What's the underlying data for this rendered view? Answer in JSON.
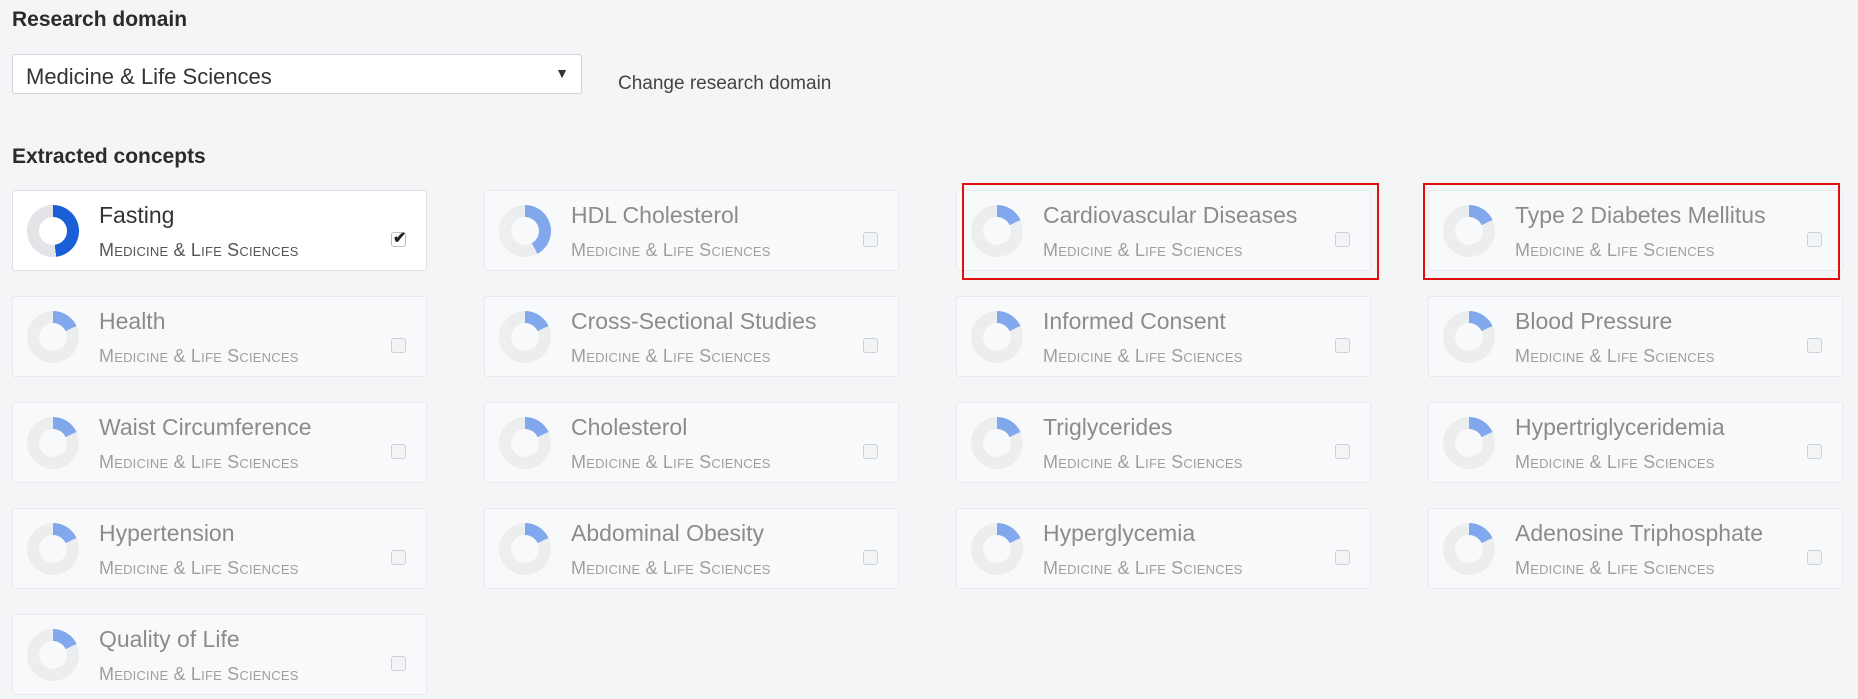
{
  "research_domain": {
    "heading": "Research domain",
    "selected": "Medicine & Life Sciences",
    "caret": "▼",
    "change_link": "Change research domain"
  },
  "concepts": {
    "heading": "Extracted concepts",
    "check_glyph": "✔",
    "items": [
      {
        "title": "Fasting",
        "category": "Medicine & Life Sciences",
        "checked": true,
        "weight": "strong"
      },
      {
        "title": "HDL Cholesterol",
        "category": "Medicine & Life Sciences",
        "checked": false,
        "weight": "mid"
      },
      {
        "title": "Cardiovascular Diseases",
        "category": "Medicine & Life Sciences",
        "checked": false,
        "weight": "low",
        "highlighted": true
      },
      {
        "title": "Type 2 Diabetes Mellitus",
        "category": "Medicine & Life Sciences",
        "checked": false,
        "weight": "low",
        "highlighted": true
      },
      {
        "title": "Health",
        "category": "Medicine & Life Sciences",
        "checked": false,
        "weight": "low"
      },
      {
        "title": "Cross-Sectional Studies",
        "category": "Medicine & Life Sciences",
        "checked": false,
        "weight": "low"
      },
      {
        "title": "Informed Consent",
        "category": "Medicine & Life Sciences",
        "checked": false,
        "weight": "low"
      },
      {
        "title": "Blood Pressure",
        "category": "Medicine & Life Sciences",
        "checked": false,
        "weight": "low"
      },
      {
        "title": "Waist Circumference",
        "category": "Medicine & Life Sciences",
        "checked": false,
        "weight": "low"
      },
      {
        "title": "Cholesterol",
        "category": "Medicine & Life Sciences",
        "checked": false,
        "weight": "low"
      },
      {
        "title": "Triglycerides",
        "category": "Medicine & Life Sciences",
        "checked": false,
        "weight": "low"
      },
      {
        "title": "Hypertriglyceridemia",
        "category": "Medicine & Life Sciences",
        "checked": false,
        "weight": "low"
      },
      {
        "title": "Hypertension",
        "category": "Medicine & Life Sciences",
        "checked": false,
        "weight": "low"
      },
      {
        "title": "Abdominal Obesity",
        "category": "Medicine & Life Sciences",
        "checked": false,
        "weight": "low"
      },
      {
        "title": "Hyperglycemia",
        "category": "Medicine & Life Sciences",
        "checked": false,
        "weight": "low"
      },
      {
        "title": "Adenosine Triphosphate",
        "category": "Medicine & Life Sciences",
        "checked": false,
        "weight": "low"
      },
      {
        "title": "Quality of Life",
        "category": "Medicine & Life Sciences",
        "checked": false,
        "weight": "low"
      }
    ]
  },
  "colors": {
    "accent_strong": "#1a5fd6",
    "accent_mid": "#4f86e8",
    "highlight_box": "#e01010"
  }
}
